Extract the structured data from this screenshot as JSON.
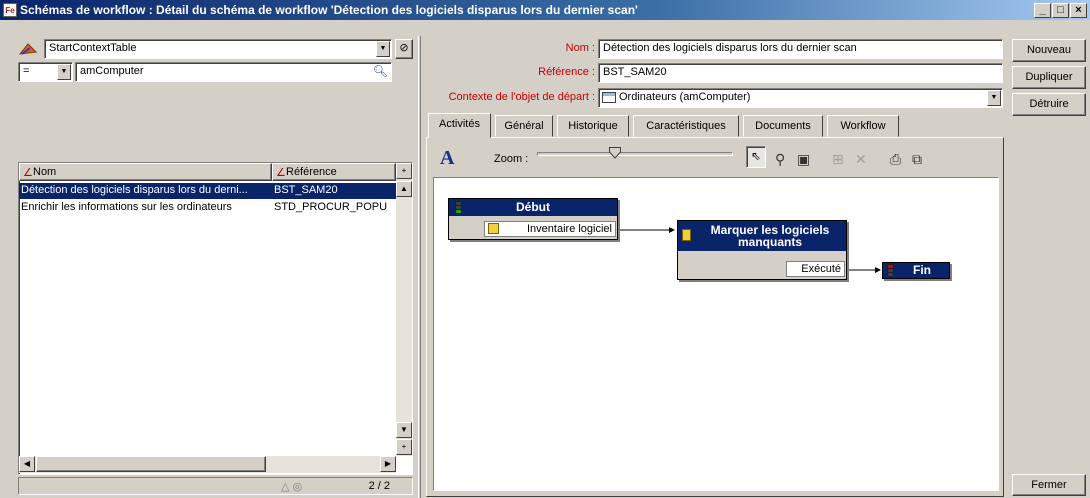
{
  "window": {
    "icon_text": "Fe",
    "title": "Schémas de workflow : Détail du schéma de workflow 'Détection des logiciels disparus lors du dernier scan'",
    "minimize": "_",
    "maximize": "□",
    "close": "×"
  },
  "left_panel": {
    "context_combo_value": "StartContextTable",
    "operator_value": "=",
    "filter_value": "amComputer",
    "list": {
      "columns": [
        "Nom",
        "Référence"
      ],
      "rows": [
        {
          "nom": "Détection des logiciels disparus lors du derni...",
          "ref": "BST_SAM20",
          "selected": true
        },
        {
          "nom": "Enrichir les informations sur les ordinateurs",
          "ref": "STD_PROCUR_POPU",
          "selected": false
        }
      ],
      "counter": "2 / 2"
    }
  },
  "form": {
    "nom_label": "Nom :",
    "nom_value": "Détection des logiciels disparus lors du dernier scan",
    "reference_label": "Référence :",
    "reference_value": "BST_SAM20",
    "contexte_label": "Contexte de l'objet de départ :",
    "contexte_value": "Ordinateurs (amComputer)"
  },
  "buttons": {
    "nouveau": "Nouveau",
    "dupliquer": "Dupliquer",
    "detruire": "Détruire",
    "fermer": "Fermer"
  },
  "tabs": [
    {
      "label": "Activités",
      "active": true
    },
    {
      "label": "Général",
      "active": false
    },
    {
      "label": "Historique",
      "active": false
    },
    {
      "label": "Caractéristiques",
      "active": false
    },
    {
      "label": "Documents",
      "active": false
    },
    {
      "label": "Workflow",
      "active": false
    }
  ],
  "toolbar": {
    "font_glyph": "A",
    "zoom_label": "Zoom :",
    "zoom_level": 0.4,
    "icons": [
      "pointer-icon",
      "zoom-icon",
      "window-icon",
      "add-activity-icon",
      "delete-icon",
      "print-icon",
      "copy-icon"
    ]
  },
  "diagram": {
    "debut": {
      "title": "Début",
      "output": "Inventaire logiciel"
    },
    "marquer": {
      "title": "Marquer les logiciels manquants",
      "output": "Exécuté"
    },
    "fin": {
      "title": "Fin"
    }
  }
}
